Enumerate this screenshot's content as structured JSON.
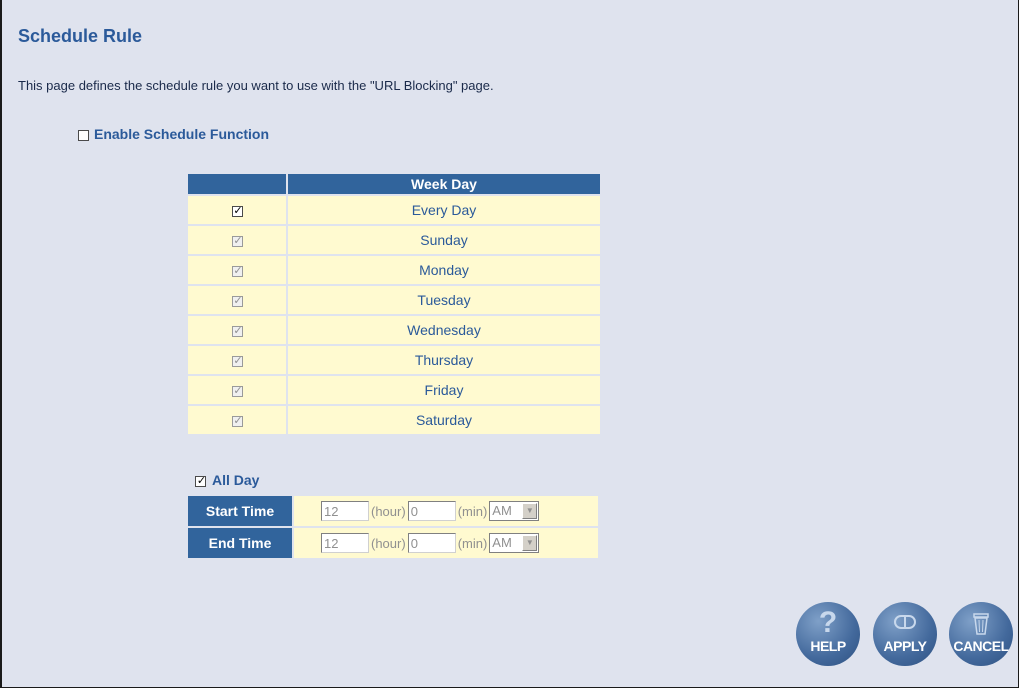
{
  "page": {
    "title": "Schedule Rule",
    "description": "This page defines the schedule rule you want to use with the \"URL Blocking\" page."
  },
  "enable_schedule": {
    "label": "Enable Schedule Function",
    "checked": false
  },
  "week_table": {
    "header": "Week Day",
    "rows": [
      {
        "label": "Every Day",
        "checked": true,
        "disabled": false
      },
      {
        "label": "Sunday",
        "checked": true,
        "disabled": true
      },
      {
        "label": "Monday",
        "checked": true,
        "disabled": true
      },
      {
        "label": "Tuesday",
        "checked": true,
        "disabled": true
      },
      {
        "label": "Wednesday",
        "checked": true,
        "disabled": true
      },
      {
        "label": "Thursday",
        "checked": true,
        "disabled": true
      },
      {
        "label": "Friday",
        "checked": true,
        "disabled": true
      },
      {
        "label": "Saturday",
        "checked": true,
        "disabled": true
      }
    ]
  },
  "all_day": {
    "label": "All Day",
    "checked": true
  },
  "start_time": {
    "label": "Start Time",
    "hour": "12",
    "hour_unit": "(hour)",
    "min": "0",
    "min_unit": "(min)",
    "ampm": "AM"
  },
  "end_time": {
    "label": "End Time",
    "hour": "12",
    "hour_unit": "(hour)",
    "min": "0",
    "min_unit": "(min)",
    "ampm": "AM"
  },
  "buttons": {
    "help": "HELP",
    "apply": "APPLY",
    "cancel": "CANCEL"
  },
  "icons": {
    "help_icon": "question-mark-icon",
    "apply_icon": "pill-icon",
    "cancel_icon": "trash-can-icon",
    "checkbox_tick": "checkmark-icon",
    "select_arrow": "triangle-down-icon"
  },
  "colors": {
    "background": "#dfe3ee",
    "heading": "#2b5a9a",
    "table_header": "#31649c",
    "row_bg": "#fffad0"
  }
}
